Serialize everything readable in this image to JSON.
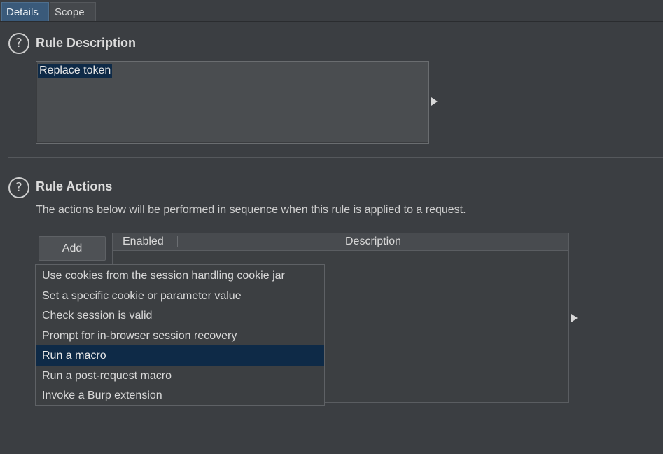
{
  "tabs": [
    {
      "label": "Details",
      "active": true
    },
    {
      "label": "Scope",
      "active": false
    }
  ],
  "rule_description": {
    "title": "Rule Description",
    "help_icon": "question-circle-icon",
    "value": "Replace token"
  },
  "rule_actions": {
    "title": "Rule Actions",
    "help_icon": "question-circle-icon",
    "description": "The actions below will be performed in sequence when this rule is applied to a request.",
    "add_label": "Add",
    "table": {
      "columns": [
        "Enabled",
        "Description"
      ],
      "rows": []
    },
    "menu": {
      "items": [
        "Use cookies from the session handling cookie jar",
        "Set a specific cookie or parameter value",
        "Check session is valid",
        "Prompt for in-browser session recovery",
        "Run a macro",
        "Run a post-request macro",
        "Invoke a Burp extension"
      ],
      "selected_index": 4
    }
  },
  "colors": {
    "background": "#3b3e42",
    "selection": "#0e2a47",
    "active_tab": "#3a5a7a"
  }
}
